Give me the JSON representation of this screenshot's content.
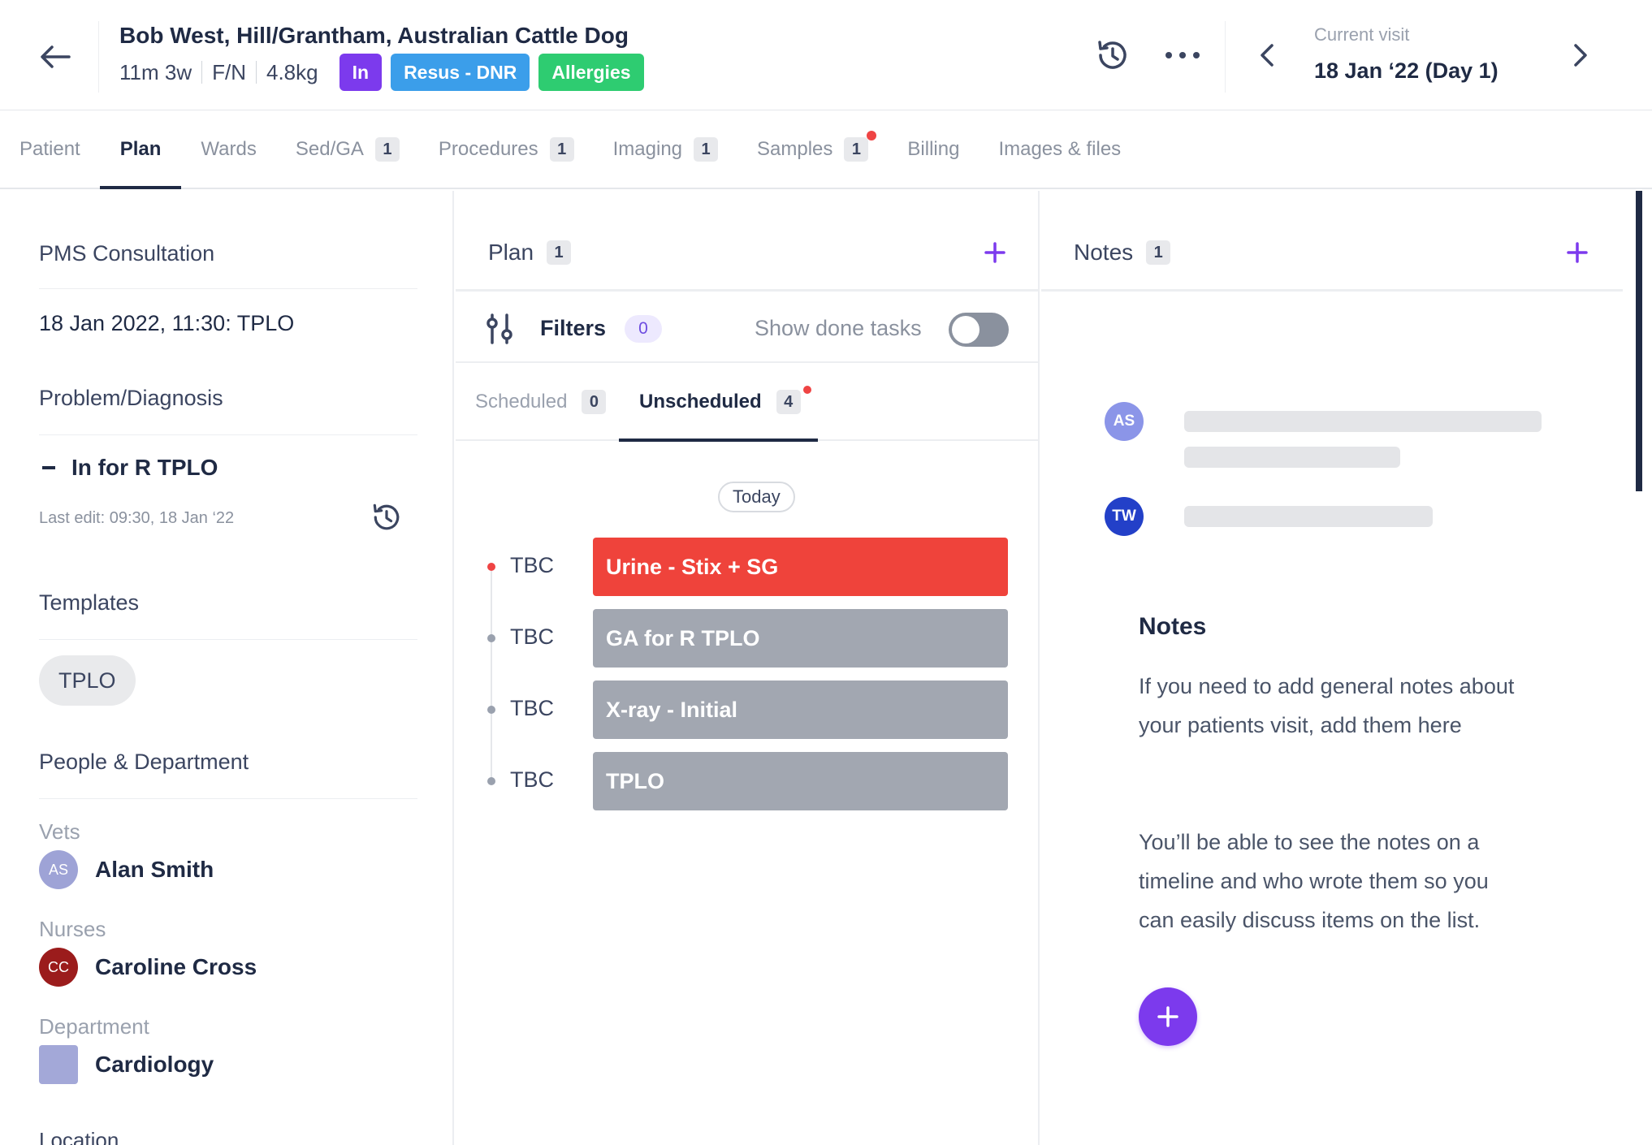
{
  "header": {
    "patient_name": "Bob West, Hill/Grantham, Australian Cattle Dog",
    "age": "11m 3w",
    "sex": "F/N",
    "weight": "4.8kg",
    "badges": [
      {
        "label": "In",
        "color": "#7c3aed"
      },
      {
        "label": "Resus - DNR",
        "color": "#3b9eea"
      },
      {
        "label": "Allergies",
        "color": "#2ecc71"
      }
    ],
    "visit_label": "Current visit",
    "visit_value": "18 Jan ‘22 (Day 1)",
    "icons": {
      "back": "arrow-left-icon",
      "history": "history-icon",
      "more": "more-horizontal-icon",
      "prev": "chevron-left-icon",
      "next": "chevron-right-icon"
    }
  },
  "tabs": [
    {
      "label": "Patient"
    },
    {
      "label": "Plan",
      "active": true
    },
    {
      "label": "Wards"
    },
    {
      "label": "Sed/GA",
      "count": "1"
    },
    {
      "label": "Procedures",
      "count": "1"
    },
    {
      "label": "Imaging",
      "count": "1"
    },
    {
      "label": "Samples",
      "count": "1",
      "alert": true
    },
    {
      "label": "Billing"
    },
    {
      "label": "Images & files"
    }
  ],
  "left": {
    "consult_title": "PMS Consultation",
    "consult_value": "18 Jan 2022, 11:30: TPLO",
    "problem_title": "Problem/Diagnosis",
    "problem_item": "In for R TPLO",
    "last_edit": "Last edit: 09:30, 18 Jan ‘22",
    "templates_title": "Templates",
    "template_chip": "TPLO",
    "people_title": "People & Department",
    "vets_label": "Vets",
    "vet": {
      "initials": "AS",
      "name": "Alan Smith",
      "color": "#9ea3d6"
    },
    "nurses_label": "Nurses",
    "nurse": {
      "initials": "CC",
      "name": "Caroline Cross",
      "color": "#9b1c1c"
    },
    "department_label": "Department",
    "department": {
      "name": "Cardiology",
      "color": "#a3a8d8"
    },
    "location_label": "Location"
  },
  "plan": {
    "title": "Plan",
    "count": "1",
    "filters_label": "Filters",
    "filters_count": "0",
    "show_done_label": "Show done tasks",
    "show_done_on": false,
    "subtabs": [
      {
        "label": "Scheduled",
        "count": "0"
      },
      {
        "label": "Unscheduled",
        "count": "4",
        "active": true,
        "alert": true
      }
    ],
    "today_label": "Today",
    "tasks": [
      {
        "time": "TBC",
        "title": "Urine - Stix + SG",
        "status": "overdue",
        "color": "#ef433b"
      },
      {
        "time": "TBC",
        "title": "GA for R TPLO",
        "status": "pending",
        "color": "#a2a7b1"
      },
      {
        "time": "TBC",
        "title": "X-ray - Initial",
        "status": "pending",
        "color": "#a2a7b1"
      },
      {
        "time": "TBC",
        "title": "TPLO",
        "status": "pending",
        "color": "#a2a7b1"
      }
    ]
  },
  "notes": {
    "title": "Notes",
    "count": "1",
    "placeholder_avatars": [
      {
        "initials": "AS",
        "color": "#8b95e8"
      },
      {
        "initials": "TW",
        "color": "#2340c8"
      }
    ],
    "empty_title": "Notes",
    "empty_text_1": "If you need to add general notes about your patients visit, add them here",
    "empty_text_2": "You’ll be able to see the notes on a timeline and who wrote them so you can easily discuss items on the list."
  },
  "colors": {
    "accent": "#7c3aed",
    "alert": "#ef4444",
    "text": "#1f2a44"
  }
}
